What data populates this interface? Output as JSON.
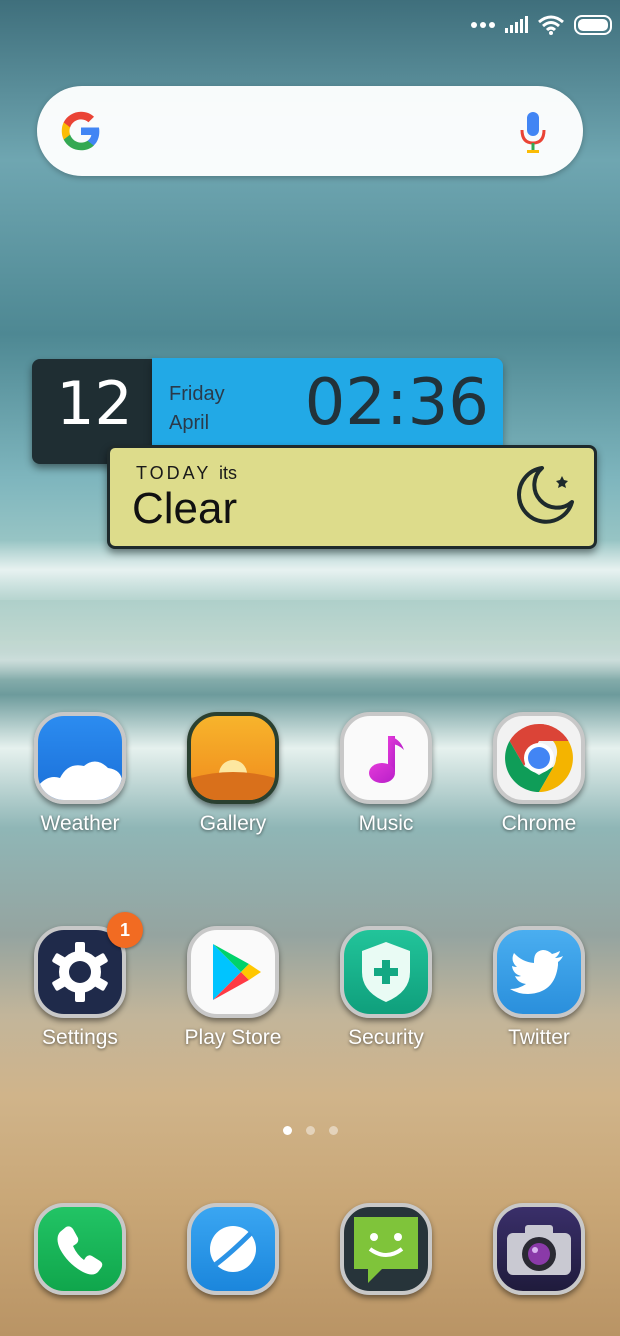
{
  "status_bar": {
    "icons": [
      "more-dots-icon",
      "signal-icon",
      "wifi-icon",
      "battery-icon"
    ]
  },
  "search_bar": {
    "logo": "google-g-icon",
    "mic": "mic-icon"
  },
  "clock_widget": {
    "date_number": "12",
    "weekday": "Friday",
    "month": "April",
    "time": "02:36"
  },
  "weather_widget": {
    "today_prefix": "TODAY",
    "today_suffix": "its",
    "condition": "Clear",
    "icon": "moon-star-icon"
  },
  "apps_row1": [
    {
      "label": "Weather"
    },
    {
      "label": "Gallery"
    },
    {
      "label": "Music"
    },
    {
      "label": "Chrome"
    }
  ],
  "apps_row2": [
    {
      "label": "Settings",
      "badge": "1"
    },
    {
      "label": "Play Store"
    },
    {
      "label": "Security"
    },
    {
      "label": "Twitter"
    }
  ],
  "page_indicator": {
    "count": 3,
    "active": 1
  },
  "dock": [
    {
      "icon": "phone-icon"
    },
    {
      "icon": "browser-icon"
    },
    {
      "icon": "messaging-icon"
    },
    {
      "icon": "camera-icon"
    }
  ]
}
